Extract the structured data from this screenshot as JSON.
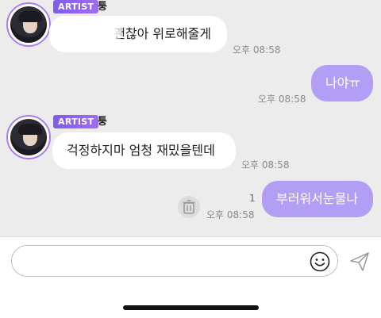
{
  "messages": {
    "group1": {
      "badge": "ARTIST",
      "sender": "퉁",
      "bubble1_text": "괜찮아 위로해줄게",
      "bubble1_time": "오후 08:58"
    },
    "outgoing1": {
      "text": "나야ㅠ",
      "time": "오후 08:58"
    },
    "group2": {
      "badge": "ARTIST",
      "sender": "퉁",
      "bubble_text": "걱정하지마 엄청 재밌을텐데",
      "time": "오후 08:58"
    },
    "outgoing2": {
      "text": "부러워서눈물나",
      "unread": "1",
      "time": "오후 08:58"
    }
  },
  "composer": {
    "placeholder": "",
    "emoji_icon": "smiley-icon",
    "send_icon": "paper-plane-icon"
  },
  "colors": {
    "accent": "#a87df0",
    "outgoing_bubble": "#b39ef5",
    "background": "#ececec"
  }
}
